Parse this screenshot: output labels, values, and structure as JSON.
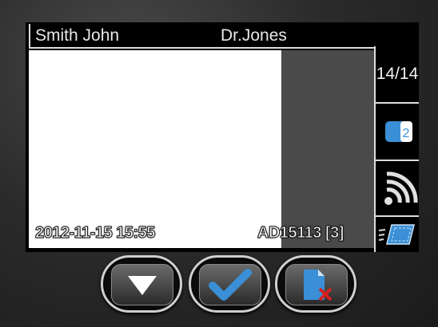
{
  "header": {
    "patient_name": "Smith John",
    "doctor_name": "Dr.Jones"
  },
  "image": {
    "timestamp": "2012-11-15 15:55",
    "accession": "AD15113 [3]"
  },
  "sidebar": {
    "page_counter": "14/14",
    "copies_badge": "2"
  },
  "icons": {
    "copies": "copies-icon",
    "wireless": "wireless-icon",
    "image_slide": "image-slide-icon",
    "down": "down-arrow-icon",
    "confirm": "checkmark-icon",
    "delete": "delete-document-icon"
  },
  "colors": {
    "accent_blue": "#3a8fd6",
    "delete_red": "#d62020",
    "text": "#e6e6e6"
  }
}
